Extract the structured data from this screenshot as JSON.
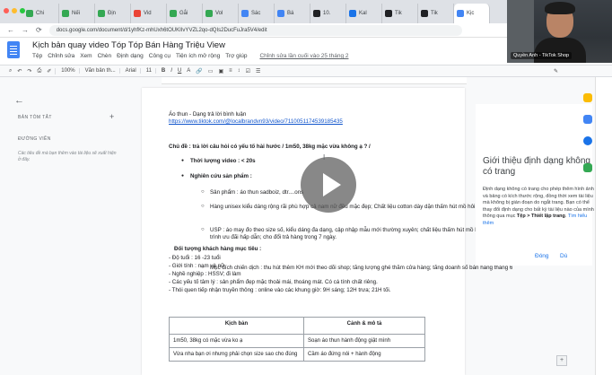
{
  "tabs": [
    {
      "label": "Chi",
      "color": "#34a853"
    },
    {
      "label": "Nếi",
      "color": "#34a853"
    },
    {
      "label": "Địn",
      "color": "#34a853"
    },
    {
      "label": "Vid",
      "color": "#ea4335"
    },
    {
      "label": "Gắi",
      "color": "#34a853"
    },
    {
      "label": "Vol",
      "color": "#34a853"
    },
    {
      "label": "Sác",
      "color": "#4285f4"
    },
    {
      "label": "Bá",
      "color": "#4285f4"
    },
    {
      "label": "10.",
      "color": "#202124"
    },
    {
      "label": "Kal",
      "color": "#1a73e8"
    },
    {
      "label": "Tik",
      "color": "#202124"
    },
    {
      "label": "Tik",
      "color": "#202124"
    },
    {
      "label": "Kịc",
      "color": "#4285f4"
    }
  ],
  "address_bar": {
    "url": "docs.google.com/document/d/1yhfKz-mhUxh6tOUKIIvYVZL2qo-dQIs2DucFuJra5V4/edit"
  },
  "doc": {
    "title": "Kịch bản quay video Tóp Tóp Bán Hàng Triệu View",
    "menu": [
      "Tệp",
      "Chỉnh sửa",
      "Xem",
      "Chèn",
      "Định dạng",
      "Công cụ",
      "Tiện ích mở rộng",
      "Trợ giúp"
    ],
    "last_edit": "Chỉnh sửa lần cuối vào 25 tháng 2"
  },
  "toolbar": {
    "zoom": "100%",
    "style": "Văn bản th...",
    "font": "Arial",
    "size": "11",
    "mode_icon": "✎"
  },
  "sidebar": {
    "back": "←",
    "summary": "BẢN TÓM TẮT",
    "plus": "+",
    "outline": "ĐƯỜNG VIỀN",
    "hint": "Các tiêu đề mà bạn thêm vào tài liệu sẽ xuất hiện ở đây."
  },
  "content": {
    "heading": "Áo thun - Dạng trả lời bình luận",
    "link": "https://www.tiktok.com/@localbrandvn93/video/7110051174539185435",
    "topic": "Chủ đề : trả lời câu hỏi có yếu tố hài hước /    1m50, 38kg mặc vừa không ạ ? /",
    "b1": "Thời lượng video : < 20s",
    "b2": "Nghiên cứu sản phẩm :",
    "s1": "Sản phẩm : áo thun sadboiz, dtr....ons",
    "s2": "Hàng unisex kiểu dáng rộng rãi phù hợp cả nam nữ đều mặc đẹp; Chất liệu cotton dày dặn thấm hút mồ hôi",
    "s3": "USP : áo may đo theo size số, kiểu dáng đa dạng, cập nhập mẫu mới thường xuyên; chất liệu thấm hút mồ hôi tốt; các chương trình ưu đãi hấp dẫn; cho đổi trả hàng trong 7 ngày.",
    "s4": "Mục đích chiến dịch : thu hút thêm KH mới theo dõi shop; tăng lượng ghé thăm cửa hàng; tăng doanh số bán hàng tháng 6",
    "target_title": "Đối tượng khách hàng mục tiêu :",
    "t1": "- Độ tuổi  : 16 -23 tuổi",
    "t2": "- Giới tính : nam và nữ",
    "t3": "- Nghề nghiệp : HSSV; đi làm",
    "t4": "- Các yếu tố tâm lý : sản phẩm đẹp mặc thoải mái, thoáng mát. Có cá tính chất riêng.",
    "t5": "- Thói quen tiếp nhận truyền thông : online vào các khung giờ: 9H sáng; 12H trưa; 21H tối."
  },
  "table": {
    "headers": [
      "Kịch bản",
      "Cảnh & mô tả"
    ],
    "rows": [
      [
        "1m50, 38kg có mặc vừa ko ạ",
        "Soạn áo thun hành động giật mình"
      ],
      [
        "Vừa nha bạn ơi nhưng phải chọn size sao cho đúng",
        "Cầm áo đứng nói + hành động"
      ]
    ]
  },
  "explore_panel": {
    "title": "Giới thiệu định dạng không có trang",
    "body_1": "Định dạng không có trang cho phép thêm hình ảnh và bảng có kích thước rộng, đồng thời xem tài liệu mà không bị gián đoạn do ngắt trang. Bạn có thể thay đổi định dạng cho bất kỳ tài liệu nào của mình thông qua mục ",
    "body_bold": "Tệp > Thiết lập trang",
    "body_link": "Tìm hiểu thêm",
    "close": "Đóng",
    "more": "Dù"
  },
  "webcam": {
    "label": "Quyền Anh - TikTok Shop"
  },
  "colors": {
    "accent": "#1a73e8",
    "link": "#1155cc",
    "docs_blue": "#4285f4"
  }
}
